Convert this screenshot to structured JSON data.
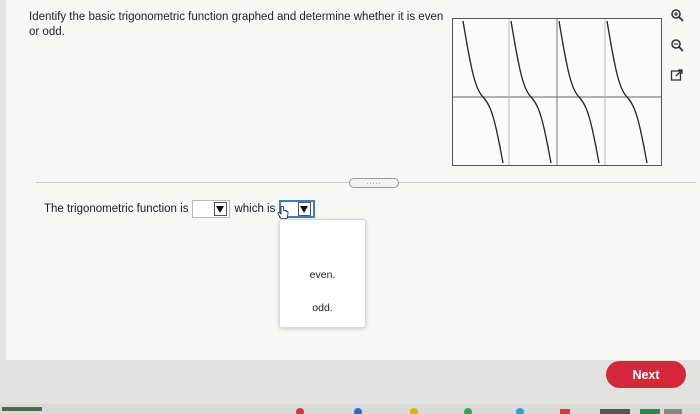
{
  "question": {
    "text": "Identify the basic trigonometric function graphed and determine whether it is even or odd."
  },
  "answer": {
    "prefix": "The trigonometric function is",
    "middle": "which is",
    "function_select_value": "",
    "parity_select_value": ""
  },
  "dropdown": {
    "options": [
      "even.",
      "odd."
    ]
  },
  "divider": {
    "handle_label": "....."
  },
  "buttons": {
    "next": "Next"
  },
  "tools": [
    "zoom-in-icon",
    "zoom-out-icon",
    "open-external-icon"
  ],
  "colors": {
    "next_button": "#d6263a",
    "focus": "#3a7bd5"
  }
}
